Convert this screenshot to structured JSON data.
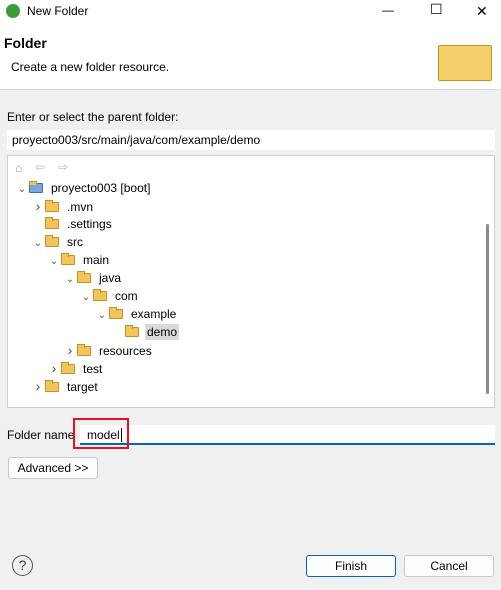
{
  "window": {
    "title": "New Folder",
    "minimize": "—",
    "maximize": "☐",
    "close": "✕"
  },
  "header": {
    "title": "Folder",
    "subtitle": "Create a new folder resource."
  },
  "parent": {
    "label": "Enter or select the parent folder:",
    "value": "proyecto003/src/main/java/com/example/demo"
  },
  "tree": [
    {
      "label": "proyecto003 [boot]",
      "level": 0,
      "chevron": "expanded",
      "icon": "project"
    },
    {
      "label": ".mvn",
      "level": 1,
      "chevron": "collapsed",
      "icon": "folder"
    },
    {
      "label": ".settings",
      "level": 1,
      "chevron": "none",
      "icon": "folder"
    },
    {
      "label": "src",
      "level": 1,
      "chevron": "expanded",
      "icon": "folder"
    },
    {
      "label": "main",
      "level": 2,
      "chevron": "expanded",
      "icon": "folder"
    },
    {
      "label": "java",
      "level": 3,
      "chevron": "expanded",
      "icon": "folder"
    },
    {
      "label": "com",
      "level": 4,
      "chevron": "expanded",
      "icon": "folder"
    },
    {
      "label": "example",
      "level": 5,
      "chevron": "expanded",
      "icon": "folder"
    },
    {
      "label": "demo",
      "level": 6,
      "chevron": "none",
      "icon": "folder",
      "selected": true
    },
    {
      "label": "resources",
      "level": 3,
      "chevron": "collapsed",
      "icon": "folder"
    },
    {
      "label": "test",
      "level": 2,
      "chevron": "collapsed",
      "icon": "folder"
    },
    {
      "label": "target",
      "level": 1,
      "chevron": "collapsed",
      "icon": "folder"
    }
  ],
  "folder_name": {
    "label": "Folder name",
    "value": "model"
  },
  "buttons": {
    "advanced": "Advanced >>",
    "finish": "Finish",
    "cancel": "Cancel",
    "help": "?"
  },
  "colors": {
    "accent": "#0a64ad",
    "highlight": "#e81123",
    "selection": "#d9d9d9"
  }
}
